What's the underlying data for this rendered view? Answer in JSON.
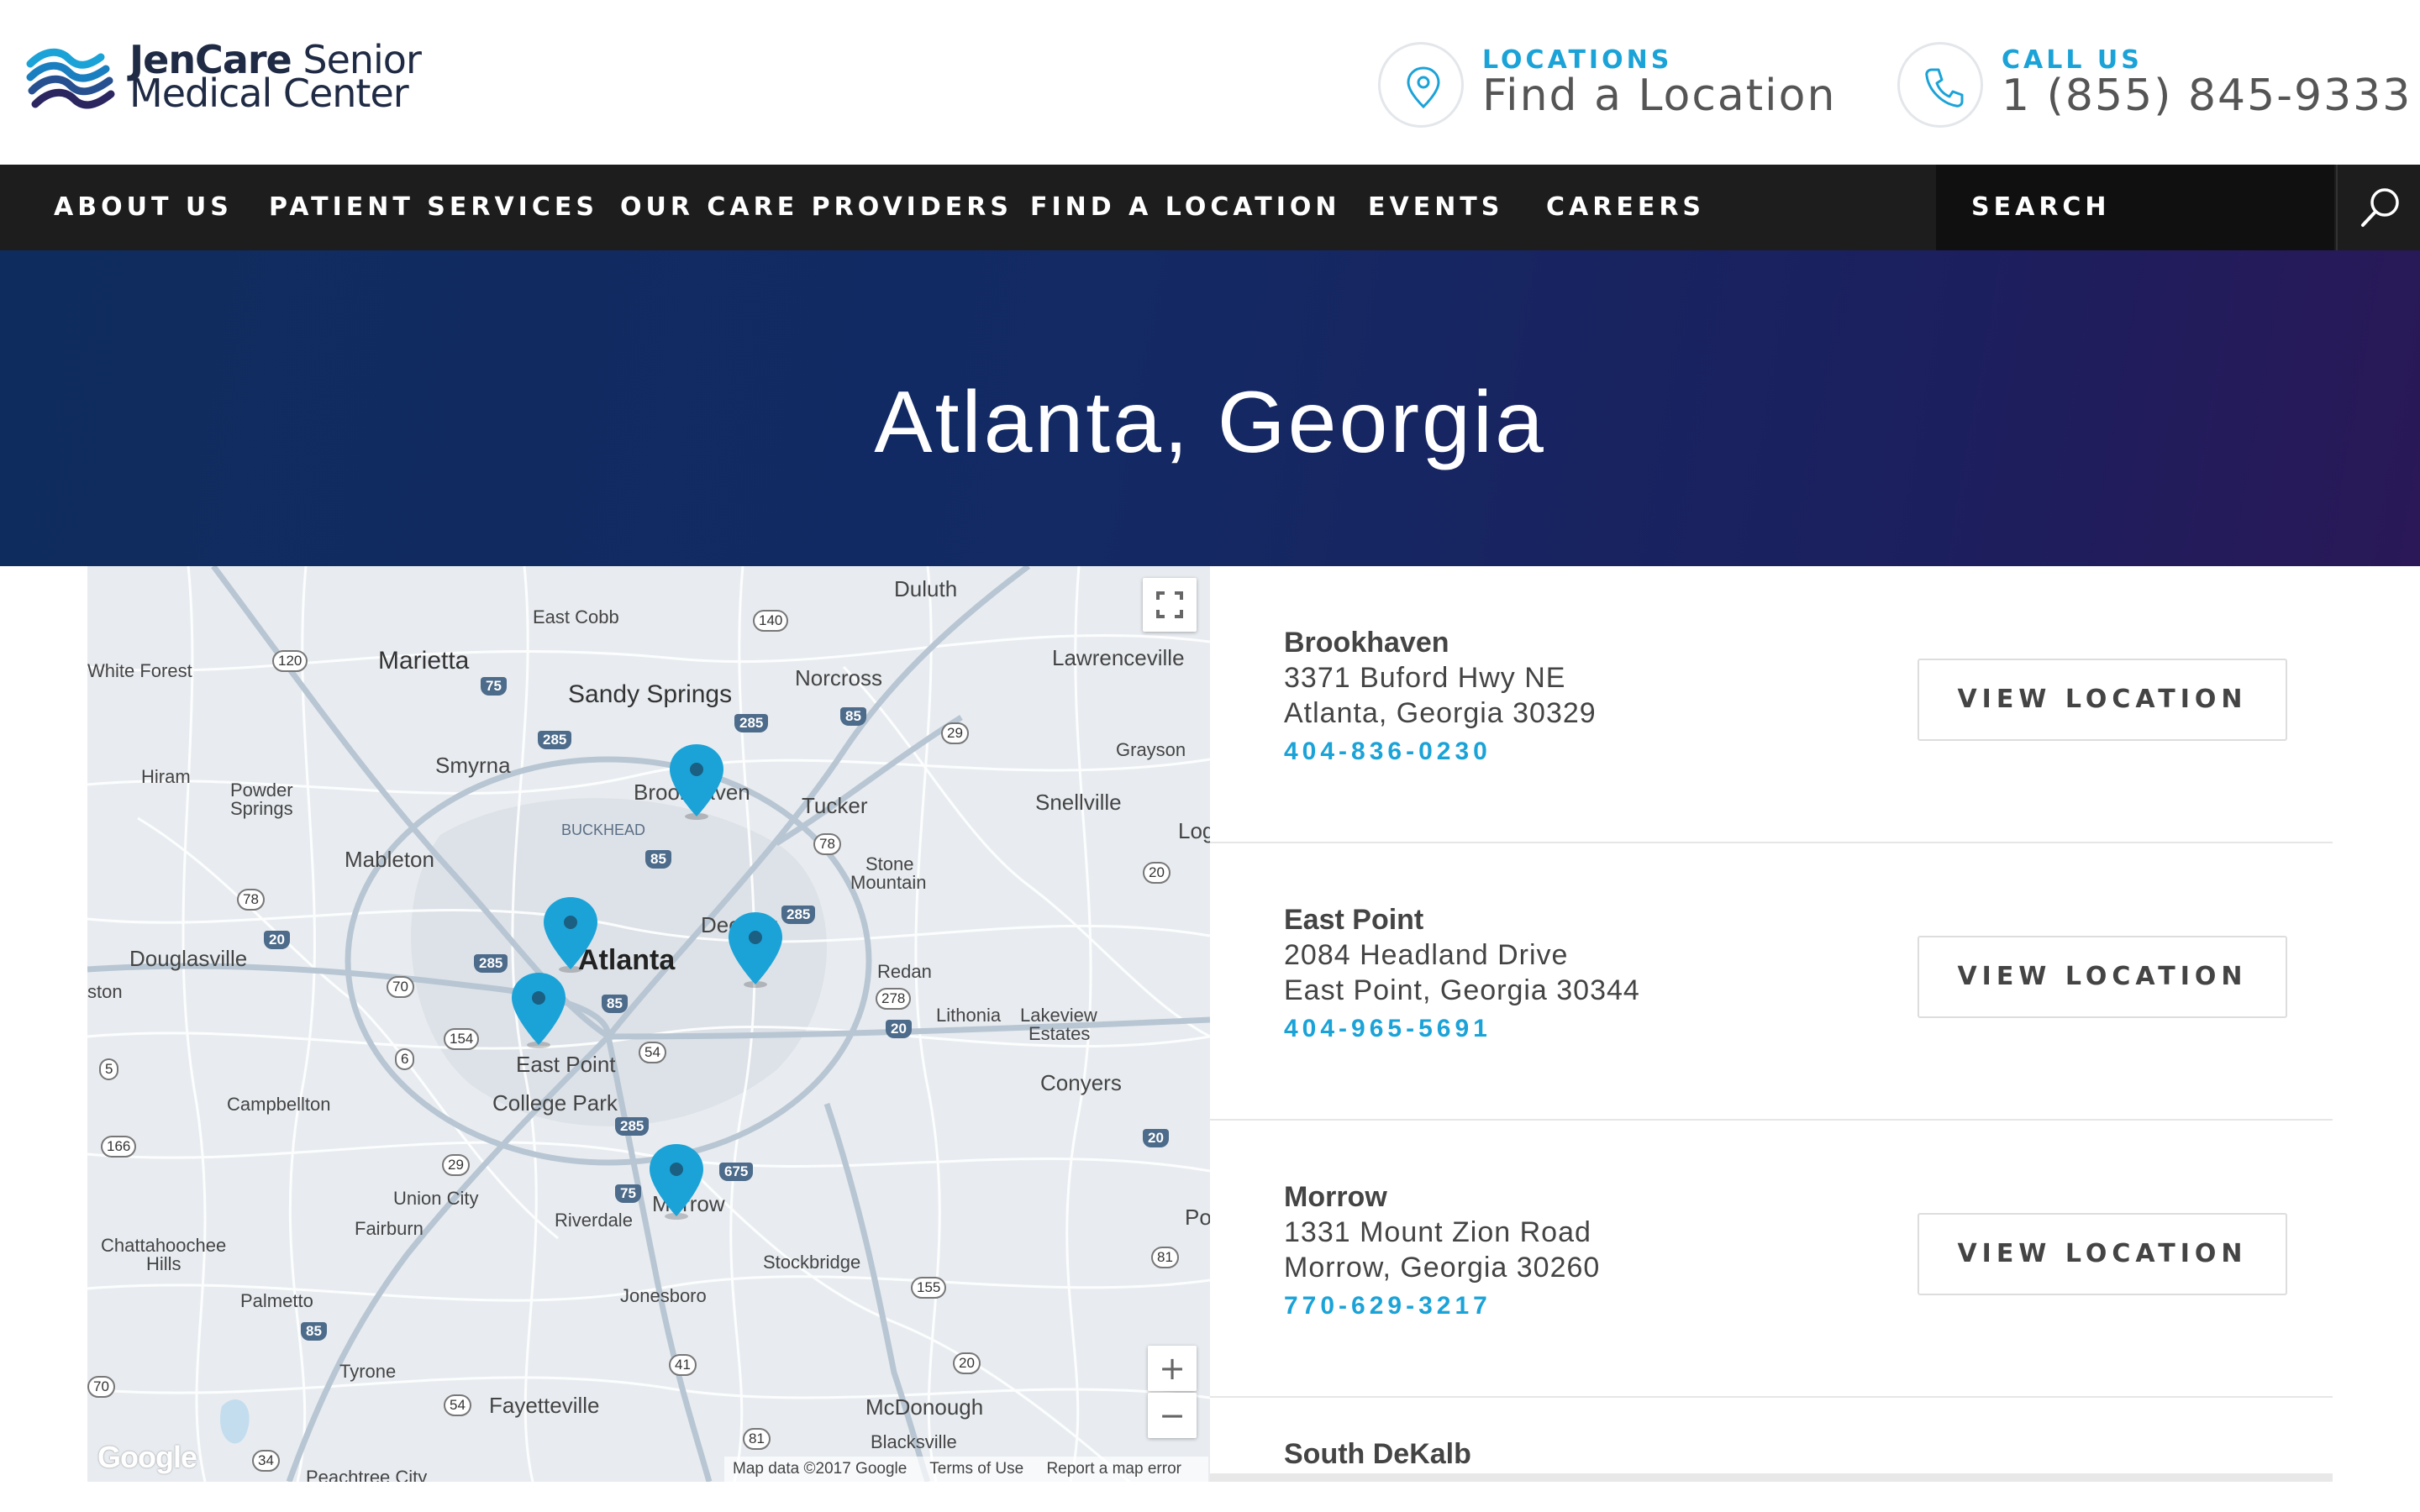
{
  "brand": {
    "name_bold": "JenCare",
    "name_rest": " Senior",
    "name_line2": "Medical Center",
    "colors": {
      "accent": "#1ba3d8",
      "nav_bg": "#1d1d1d",
      "hero_start": "#0f2c5e",
      "hero_end": "#2a1858",
      "pin": "#1ba3d8"
    }
  },
  "header": {
    "locations": {
      "icon": "location-pin-icon",
      "kicker": "LOCATIONS",
      "text": "Find a Location"
    },
    "call": {
      "icon": "phone-icon",
      "kicker": "CALL US",
      "text": "1 (855) 845-9333"
    }
  },
  "nav": {
    "items": [
      {
        "label": "ABOUT US"
      },
      {
        "label": "PATIENT SERVICES"
      },
      {
        "label": "OUR CARE PROVIDERS"
      },
      {
        "label": "FIND A LOCATION"
      },
      {
        "label": "EVENTS"
      },
      {
        "label": "CAREERS"
      }
    ],
    "search_label": "SEARCH",
    "search_icon": "search-icon"
  },
  "hero": {
    "title": "Atlanta, Georgia"
  },
  "map": {
    "labels": {
      "duluth": "Duluth",
      "east_cobb": "East Cobb",
      "marietta": "Marietta",
      "white_forest": "White Forest",
      "sandy_springs": "Sandy Springs",
      "norcross": "Norcross",
      "lawrenceville": "Lawrenceville",
      "smyrna": "Smyrna",
      "hiram": "Hiram",
      "powder": "Powder",
      "springs": "Springs",
      "brookhaven": "Brookhaven",
      "tucker": "Tucker",
      "grayson": "Grayson",
      "snellville": "Snellville",
      "buckhead": "BUCKHEAD",
      "mableton": "Mableton",
      "stone": "Stone",
      "mountain": "Mountain",
      "log": "Log",
      "douglasville": "Douglasville",
      "decatur": "Decatur",
      "atlanta": "Atlanta",
      "redan": "Redan",
      "ston": "ston",
      "lithonia": "Lithonia",
      "lakeview": "Lakeview",
      "estates": "Estates",
      "east_point": "East Point",
      "college_park": "College Park",
      "campbellton": "Campbellton",
      "conyers": "Conyers",
      "union_city": "Union City",
      "fairburn": "Fairburn",
      "riverdale": "Riverdale",
      "morrow": "Morrow",
      "chattahoochee": "Chattahoochee",
      "hills": "Hills",
      "stockbridge": "Stockbridge",
      "po": "Po",
      "palmetto": "Palmetto",
      "jonesboro": "Jonesboro",
      "tyrone": "Tyrone",
      "fayetteville": "Fayetteville",
      "mcdonough": "McDonough",
      "blacksville": "Blacksville",
      "peachtree_city": "Peachtree City"
    },
    "highways": {
      "h140": "140",
      "h120": "120",
      "h29a": "29",
      "h78a": "78",
      "h20a": "20",
      "h78b": "78",
      "h70": "70",
      "h278": "278",
      "h154": "154",
      "h6": "6",
      "h54a": "54",
      "h5": "5",
      "h166": "166",
      "h29b": "29",
      "h81a": "81",
      "h155": "155",
      "h41": "41",
      "h20b": "20",
      "h54b": "54",
      "h81b": "81",
      "h34": "34",
      "h70b": "70"
    },
    "interstates": {
      "i75a": "75",
      "i285a": "285",
      "i285b": "285",
      "i85a": "85",
      "i85b": "85",
      "i20a": "20",
      "i285c": "285",
      "i285d": "285",
      "i85c": "85",
      "i20b": "20",
      "i285e": "285",
      "i675": "675",
      "i75b": "75",
      "i20c": "20",
      "i85d": "85"
    },
    "zoom_in": "+",
    "zoom_out": "−",
    "google": "Google",
    "footer": {
      "data": "Map data ©2017 Google",
      "terms": "Terms of Use",
      "report": "Report a map error"
    }
  },
  "locations": [
    {
      "name": "Brookhaven",
      "address1": "3371 Buford Hwy NE",
      "address2": "Atlanta, Georgia 30329",
      "phone": "404-836-0230",
      "button": "VIEW LOCATION"
    },
    {
      "name": "East Point",
      "address1": "2084 Headland Drive",
      "address2": "East Point, Georgia 30344",
      "phone": "404-965-5691",
      "button": "VIEW LOCATION"
    },
    {
      "name": "Morrow",
      "address1": "1331 Mount Zion Road",
      "address2": "Morrow, Georgia 30260",
      "phone": "770-629-3217",
      "button": "VIEW LOCATION"
    },
    {
      "name": "South DeKalb"
    }
  ]
}
